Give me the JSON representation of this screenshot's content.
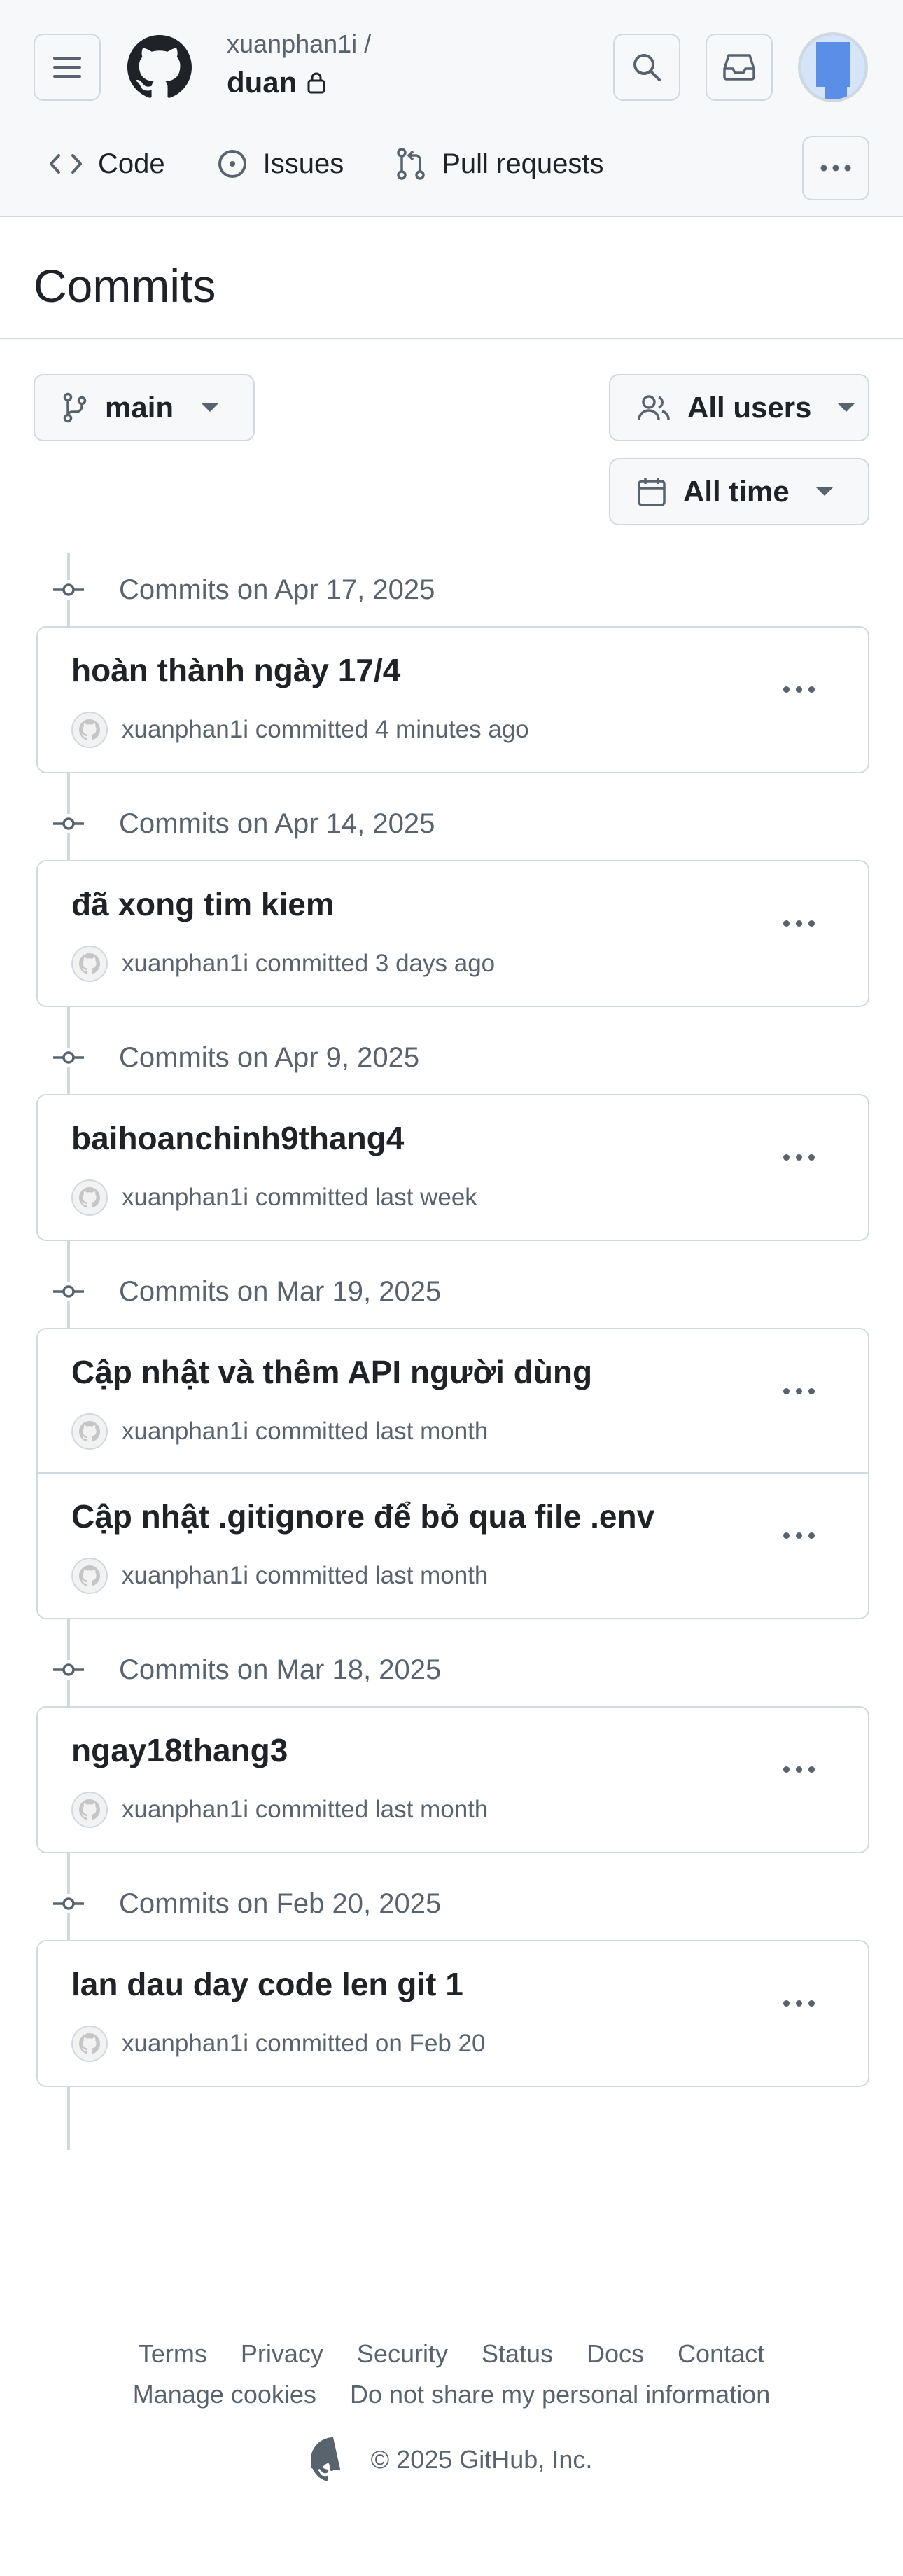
{
  "header": {
    "owner": "xuanphan1i /",
    "repo": "duan",
    "nav": [
      {
        "label": "Code"
      },
      {
        "label": "Issues"
      },
      {
        "label": "Pull requests"
      }
    ]
  },
  "page": {
    "title": "Commits"
  },
  "filters": {
    "branch": "main",
    "users": "All users",
    "time": "All time"
  },
  "groups": [
    {
      "date": "Commits on Apr 17, 2025",
      "commits": [
        {
          "message": "hoàn thành ngày 17/4",
          "author": "xuanphan1i",
          "verb": "committed",
          "when": "4 minutes ago"
        }
      ]
    },
    {
      "date": "Commits on Apr 14, 2025",
      "commits": [
        {
          "message": "đã xong tim kiem",
          "author": "xuanphan1i",
          "verb": "committed",
          "when": "3 days ago"
        }
      ]
    },
    {
      "date": "Commits on Apr 9, 2025",
      "commits": [
        {
          "message": "baihoanchinh9thang4",
          "author": "xuanphan1i",
          "verb": "committed",
          "when": "last week"
        }
      ]
    },
    {
      "date": "Commits on Mar 19, 2025",
      "commits": [
        {
          "message": "Cập nhật và thêm API người dùng",
          "author": "xuanphan1i",
          "verb": "committed",
          "when": "last month"
        },
        {
          "message": "Cập nhật .gitignore để bỏ qua file .env",
          "author": "xuanphan1i",
          "verb": "committed",
          "when": "last month"
        }
      ]
    },
    {
      "date": "Commits on Mar 18, 2025",
      "commits": [
        {
          "message": "ngay18thang3",
          "author": "xuanphan1i",
          "verb": "committed",
          "when": "last month"
        }
      ]
    },
    {
      "date": "Commits on Feb 20, 2025",
      "commits": [
        {
          "message": "lan dau day code len git 1",
          "author": "xuanphan1i",
          "verb": "committed",
          "when": "on Feb 20"
        }
      ]
    }
  ],
  "footer": {
    "links_row1": [
      "Terms",
      "Privacy",
      "Security",
      "Status",
      "Docs",
      "Contact"
    ],
    "links_row2": [
      "Manage cookies",
      "Do not share my personal information"
    ],
    "copyright": "© 2025 GitHub, Inc."
  },
  "colors": {
    "accent": "#1f2328",
    "muted": "#59636e",
    "border": "#d1d9e0",
    "header_bg": "#f6f8fa",
    "avatar": "#5b8ee6"
  }
}
